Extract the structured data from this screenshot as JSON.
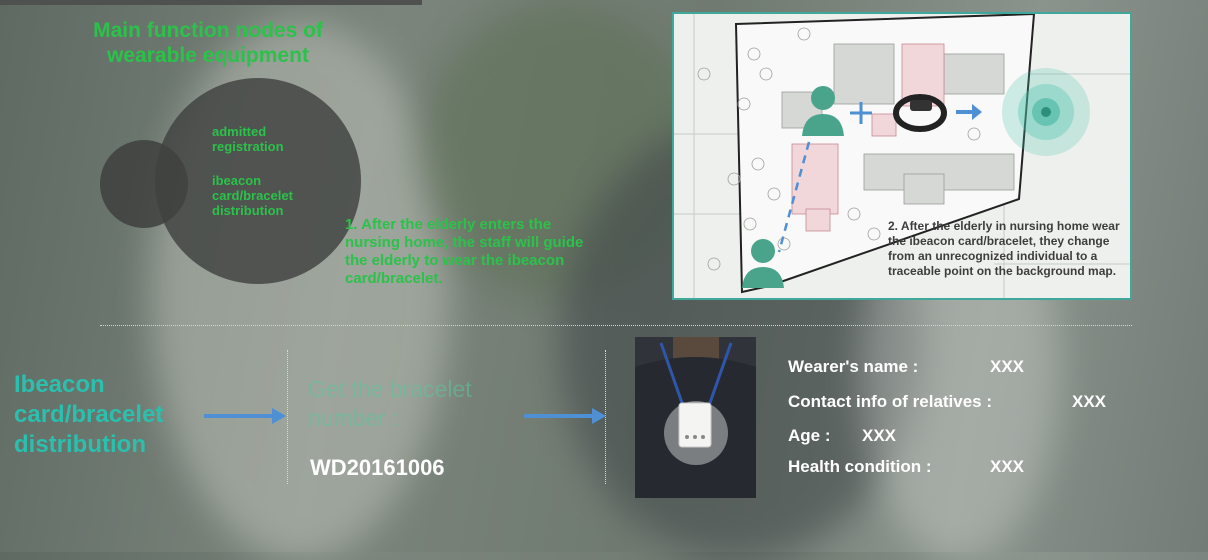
{
  "title": "Main function nodes of wearable equipment",
  "nodes": {
    "node1": "admitted registration",
    "node2": "ibeacon card/bracelet distribution"
  },
  "step1": "1. After the elderly enters the nursing home, the staff will guide the elderly to wear the ibeacon card/bracelet.",
  "step2": "2. After the elderly in nursing home wear the ibeacon card/bracelet, they change from an unrecognized individual to a traceable point on the background map.",
  "flow": {
    "distribution_label": "Ibeacon card/bracelet distribution",
    "bracelet_label": "Get the bracelet number :",
    "bracelet_number": "WD20161006"
  },
  "wearer_info": {
    "name_label": "Wearer's name :",
    "name_value": "XXX",
    "contact_label": "Contact info of relatives :",
    "contact_value": "XXX",
    "age_label": "Age :",
    "age_value": "XXX",
    "health_label": "Health condition :",
    "health_value": "XXX"
  },
  "colors": {
    "title_green": "#2bc24a",
    "teal": "#2bbfae",
    "arrow_blue": "#4f8fd4",
    "panel_border": "#3fa89a"
  }
}
